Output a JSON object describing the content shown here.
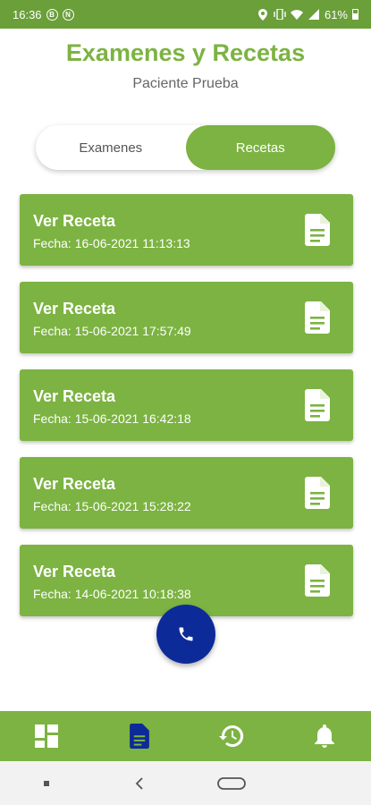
{
  "status_bar": {
    "time": "16:36",
    "left_icons": [
      "b-circle-icon",
      "n-circle-icon"
    ],
    "right_icons": [
      "location-icon",
      "vibrate-icon",
      "wifi-icon",
      "signal-icon"
    ],
    "battery": "61%"
  },
  "header": {
    "title": "Examenes y Recetas",
    "subtitle": "Paciente Prueba"
  },
  "tabs": [
    {
      "label": "Examenes",
      "active": false
    },
    {
      "label": "Recetas",
      "active": true
    }
  ],
  "recetas": [
    {
      "title": "Ver Receta",
      "date": "Fecha: 16-06-2021 11:13:13"
    },
    {
      "title": "Ver Receta",
      "date": "Fecha: 15-06-2021 17:57:49"
    },
    {
      "title": "Ver Receta",
      "date": "Fecha: 15-06-2021 16:42:18"
    },
    {
      "title": "Ver Receta",
      "date": "Fecha: 15-06-2021 15:28:22"
    },
    {
      "title": "Ver Receta",
      "date": "Fecha: 14-06-2021 10:18:38"
    }
  ],
  "fab": {
    "icon": "phone-icon"
  },
  "bottom_nav": [
    {
      "icon": "dashboard-icon",
      "active": false
    },
    {
      "icon": "document-icon",
      "active": true
    },
    {
      "icon": "history-icon",
      "active": false
    },
    {
      "icon": "bell-icon",
      "active": false
    }
  ],
  "colors": {
    "primary_green": "#7cb342",
    "status_bar_green": "#6a9f3a",
    "fab_blue": "#0d2a99",
    "active_nav": "#0d2a99"
  }
}
